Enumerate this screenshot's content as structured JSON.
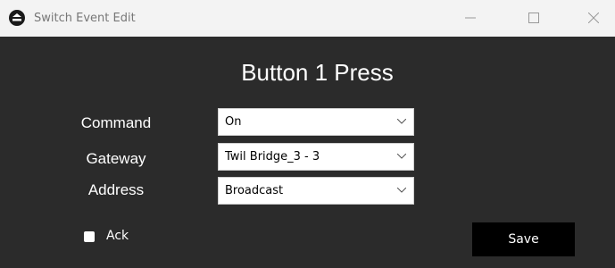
{
  "window": {
    "title": "Switch Event Edit",
    "controls": {
      "minimize_icon": "minimize-icon",
      "maximize_icon": "maximize-icon",
      "close_icon": "close-icon"
    }
  },
  "heading": "Button 1 Press",
  "form": {
    "command": {
      "label": "Command",
      "value": "On"
    },
    "gateway": {
      "label": "Gateway",
      "value": "Twil Bridge_3 - 3"
    },
    "address": {
      "label": "Address",
      "value": "Broadcast"
    },
    "ack": {
      "label": "Ack",
      "checked": false
    }
  },
  "actions": {
    "save_label": "Save"
  },
  "colors": {
    "background": "#2b2b2b",
    "titlebar": "#f3f3f3",
    "button": "#000000",
    "text": "#ffffff"
  }
}
